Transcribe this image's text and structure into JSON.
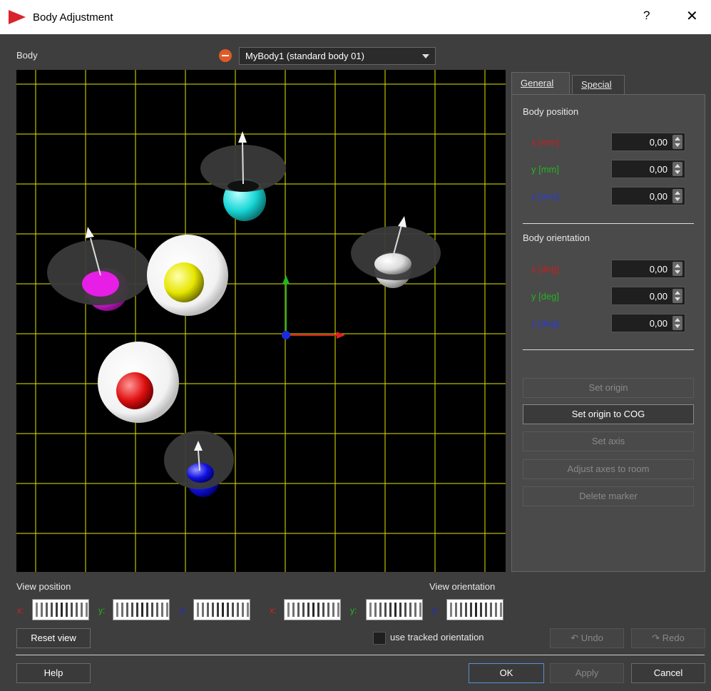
{
  "window": {
    "title": "Body Adjustment",
    "help_glyph": "?",
    "close_glyph": "✕"
  },
  "body_selector": {
    "label": "Body",
    "selected": "MyBody1 (standard body 01)"
  },
  "tabs": [
    {
      "label": "General",
      "active": true
    },
    {
      "label": "Special",
      "active": false
    }
  ],
  "position": {
    "heading": "Body position",
    "fields": [
      {
        "label": "x [mm]",
        "value": "0,00",
        "color": "#c81e1e"
      },
      {
        "label": "y [mm]",
        "value": "0,00",
        "color": "#22b422"
      },
      {
        "label": "z [mm]",
        "value": "0,00",
        "color": "#2a3bd8"
      }
    ]
  },
  "orientation": {
    "heading": "Body orientation",
    "fields": [
      {
        "label": "x [deg]",
        "value": "0,00",
        "color": "#c81e1e"
      },
      {
        "label": "y [deg]",
        "value": "0,00",
        "color": "#22b422"
      },
      {
        "label": "z [deg]",
        "value": "0,00",
        "color": "#2a3bd8"
      }
    ]
  },
  "actions": [
    {
      "label": "Set origin",
      "enabled": false
    },
    {
      "label": "Set origin to COG",
      "enabled": true
    },
    {
      "label": "Set axis",
      "enabled": false
    },
    {
      "label": "Adjust axes to room",
      "enabled": false
    },
    {
      "label": "Delete marker",
      "enabled": false
    }
  ],
  "view": {
    "position_label": "View position",
    "orientation_label": "View orientation",
    "axis_labels": [
      "x:",
      "y:",
      "z:"
    ],
    "reset_label": "Reset view",
    "tracked_label": "use tracked orientation",
    "tracked_checked": false
  },
  "history": {
    "undo_label": "Undo",
    "redo_label": "Redo"
  },
  "footer": {
    "help_label": "Help",
    "ok_label": "OK",
    "apply_label": "Apply",
    "cancel_label": "Cancel"
  },
  "colors": {
    "grid": "#e6e600",
    "accent": "#d9242b",
    "x_axis": "#e02020",
    "y_axis": "#1fb81f",
    "z_axis": "#1a2bdc"
  },
  "markers": [
    {
      "name": "cyan-marker",
      "color": "#18d6d6",
      "has_disc": true
    },
    {
      "name": "magenta-marker",
      "color": "#e61ee6",
      "has_disc": true
    },
    {
      "name": "yellow-marker",
      "color": "#e6e600",
      "has_disc": false
    },
    {
      "name": "white-marker",
      "color": "#f0f0f0",
      "has_disc": true
    },
    {
      "name": "red-marker",
      "color": "#e01010",
      "has_disc": false
    },
    {
      "name": "blue-marker",
      "color": "#1010e0",
      "has_disc": true
    }
  ]
}
